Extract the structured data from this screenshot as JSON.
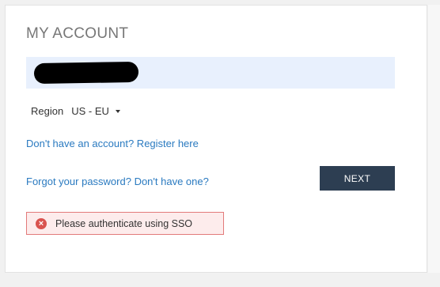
{
  "account": {
    "title": "MY ACCOUNT",
    "username_value": "",
    "region_label": "Region",
    "region_value": "US - EU",
    "register_link": "Don't have an account? Register here",
    "forgot_link": "Forgot your password? Don't have one?",
    "next_label": "NEXT",
    "error_message": "Please authenticate using SSO"
  },
  "icons": {
    "error": "error-circle-x-icon",
    "dropdown": "caret-down-icon"
  },
  "colors": {
    "accent_link": "#2a7ac0",
    "button_bg": "#2d3e52",
    "field_bg": "#e8f0fd",
    "error_border": "#e27a7a",
    "error_icon": "#d9534f"
  }
}
